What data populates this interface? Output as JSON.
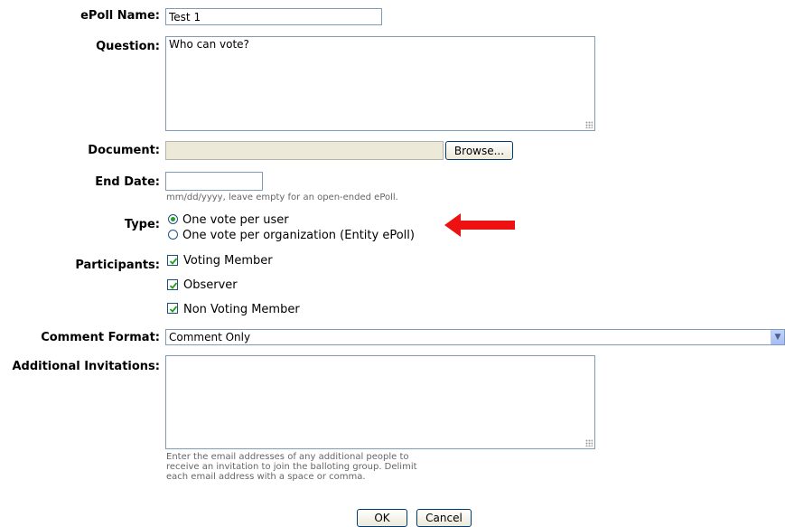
{
  "form": {
    "name_label": "ePoll Name:",
    "name_value": "Test 1",
    "question_label": "Question:",
    "question_value": "Who can vote?",
    "document_label": "Document:",
    "document_value": "",
    "browse_label": "Browse...",
    "end_date_label": "End Date:",
    "end_date_value": "",
    "end_date_hint": "mm/dd/yyyy, leave empty for an open-ended ePoll.",
    "type_label": "Type:",
    "type_options": [
      {
        "label": "One vote per user",
        "selected": true
      },
      {
        "label": "One vote per organization (Entity ePoll)",
        "selected": false
      }
    ],
    "participants_label": "Participants:",
    "participants": [
      {
        "label": "Voting Member",
        "checked": true
      },
      {
        "label": "Observer",
        "checked": true
      },
      {
        "label": "Non Voting Member",
        "checked": true
      }
    ],
    "comment_format_label": "Comment Format:",
    "comment_format_value": "Comment Only",
    "invitations_label": "Additional Invitations:",
    "invitations_value": "",
    "invitations_hint": [
      "Enter the email addresses of any additional people to",
      "receive an invitation to join the balloting group. Delimit",
      "each email address with a space or comma."
    ],
    "ok_label": "OK",
    "cancel_label": "Cancel"
  },
  "annotation": {
    "icon": "red-arrow-icon",
    "color": "#ee1111"
  },
  "colors": {
    "field_border": "#7f9db9",
    "checkmark": "#21a121"
  }
}
